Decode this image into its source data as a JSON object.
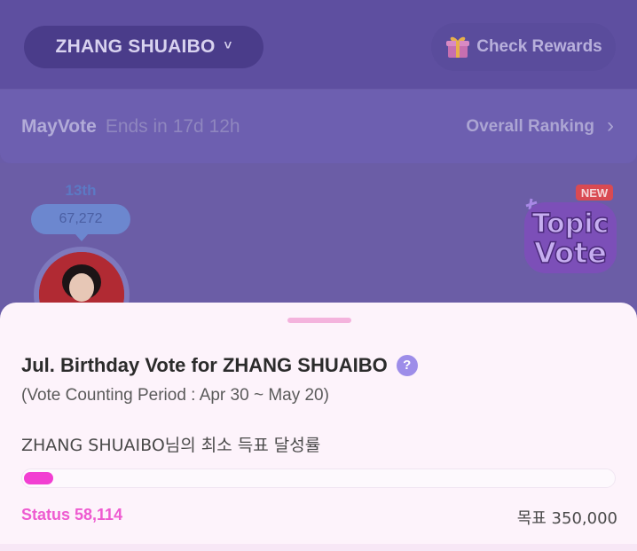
{
  "header": {
    "artist_name": "ZHANG SHUAIBO",
    "artist_chevron": "˅",
    "rewards_label": "Check Rewards"
  },
  "vote_bar": {
    "name": "MayVote",
    "ends": "Ends in 17d 12h",
    "ranking_label": "Overall Ranking",
    "ranking_arrow": "›"
  },
  "rank": {
    "position": "13th",
    "votes": "67,272"
  },
  "badge": {
    "new_label": "NEW",
    "line1": "Topic",
    "line2": "Vote"
  },
  "sheet": {
    "title": "Jul. Birthday Vote for ZHANG SHUAIBO",
    "help_glyph": "?",
    "period": "(Vote Counting Period : Apr 30 ~ May 20)",
    "achievement_label": "ZHANG SHUAIBO님의 최소 득표 달성률",
    "progress_fraction": 0.166,
    "status_text": "Status 58,114",
    "goal_text": "목표 350,000"
  },
  "colors": {
    "accent": "#f23fd2",
    "help": "#9d8de9"
  }
}
